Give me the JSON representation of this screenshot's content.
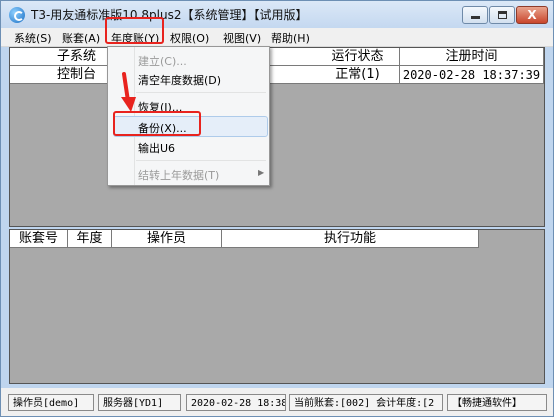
{
  "window": {
    "title": "T3-用友通标准版10.8plus2【系统管理】【试用版】",
    "close_glyph": "X"
  },
  "menubar": {
    "items": [
      "系统(S)",
      "账套(A)",
      "年度账(Y)",
      "权限(O)",
      "视图(V)",
      "帮助(H)"
    ]
  },
  "upper_table": {
    "headers": [
      "子系统",
      "运行状态",
      "注册时间"
    ],
    "rows": [
      [
        "控制台",
        "正常(1)",
        "2020-02-28 18:37:39"
      ]
    ]
  },
  "lower_table": {
    "headers": [
      "账套号",
      "年度",
      "操作员",
      "执行功能"
    ]
  },
  "dropdown": {
    "items": [
      {
        "label": "建立(C)...",
        "enabled": false
      },
      {
        "label": "清空年度数据(D)",
        "enabled": true
      },
      {
        "label": "恢复(I)...",
        "enabled": true
      },
      {
        "label": "备份(X)...",
        "enabled": true,
        "highlighted": true
      },
      {
        "label": "输出U6",
        "enabled": true
      },
      {
        "label": "结转上年数据(T)",
        "enabled": false,
        "has_submenu": true
      }
    ]
  },
  "statusbar": {
    "operator": "操作员[demo]",
    "server": "服务器[YD1]",
    "datetime": "2020-02-28 18:38",
    "current_account": "当前账套:[002] 会计年度:[2",
    "brand": "【畅捷通软件】"
  },
  "colors": {
    "annotation": "#e8231e",
    "menu_highlight": "#cde3f7",
    "table_background": "#a9a9a9"
  },
  "icons": {
    "app": "app-logo-icon",
    "minimize": "minimize-icon",
    "maximize": "maximize-icon",
    "close": "close-icon",
    "submenu": "chevron-right-icon"
  }
}
